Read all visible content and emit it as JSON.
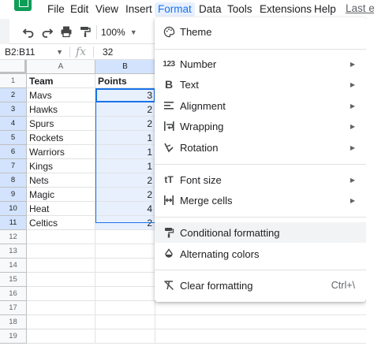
{
  "menubar": {
    "items": [
      {
        "label": "File"
      },
      {
        "label": "Edit"
      },
      {
        "label": "View"
      },
      {
        "label": "Insert"
      },
      {
        "label": "Format"
      },
      {
        "label": "Data"
      },
      {
        "label": "Tools"
      },
      {
        "label": "Extensions"
      },
      {
        "label": "Help"
      }
    ],
    "last_edit": "Last e"
  },
  "toolbar": {
    "zoom": "100%",
    "icons": [
      "undo-icon",
      "redo-icon",
      "print-icon",
      "paint-format-icon"
    ]
  },
  "formula_bar": {
    "name_box": "B2:B11",
    "fx": "fx",
    "value": "32"
  },
  "sheet": {
    "columns": [
      "A",
      "B"
    ],
    "rows": [
      "1",
      "2",
      "3",
      "4",
      "5",
      "6",
      "7",
      "8",
      "9",
      "10",
      "11",
      "12",
      "13",
      "14",
      "15",
      "16",
      "17",
      "18",
      "19"
    ],
    "header": [
      "Team",
      "Points"
    ],
    "teams": [
      "Mavs",
      "Hawks",
      "Spurs",
      "Rockets",
      "Warriors",
      "Kings",
      "Nets",
      "Magic",
      "Heat",
      "Celtics"
    ],
    "points_visible": [
      "3",
      "2",
      "2",
      "1",
      "1",
      "1",
      "2",
      "2",
      "4",
      "2"
    ],
    "selection_color": "#1a73e8"
  },
  "format_menu": {
    "items": [
      {
        "label": "Theme",
        "icon": "palette-icon",
        "submenu": false
      },
      {
        "label": "Number",
        "icon": "number-123-icon",
        "submenu": true
      },
      {
        "label": "Text",
        "icon": "bold-icon",
        "submenu": true
      },
      {
        "label": "Alignment",
        "icon": "align-icon",
        "submenu": true
      },
      {
        "label": "Wrapping",
        "icon": "wrap-icon",
        "submenu": true
      },
      {
        "label": "Rotation",
        "icon": "rotate-icon",
        "submenu": true
      },
      {
        "label": "Font size",
        "icon": "font-size-icon",
        "submenu": true
      },
      {
        "label": "Merge cells",
        "icon": "merge-icon",
        "submenu": true
      },
      {
        "label": "Conditional formatting",
        "icon": "paint-roller-icon",
        "submenu": false
      },
      {
        "label": "Alternating colors",
        "icon": "drop-icon",
        "submenu": false
      },
      {
        "label": "Clear formatting",
        "icon": "clear-format-icon",
        "submenu": false,
        "shortcut": "Ctrl+\\"
      }
    ],
    "highlighted": "Conditional formatting"
  }
}
